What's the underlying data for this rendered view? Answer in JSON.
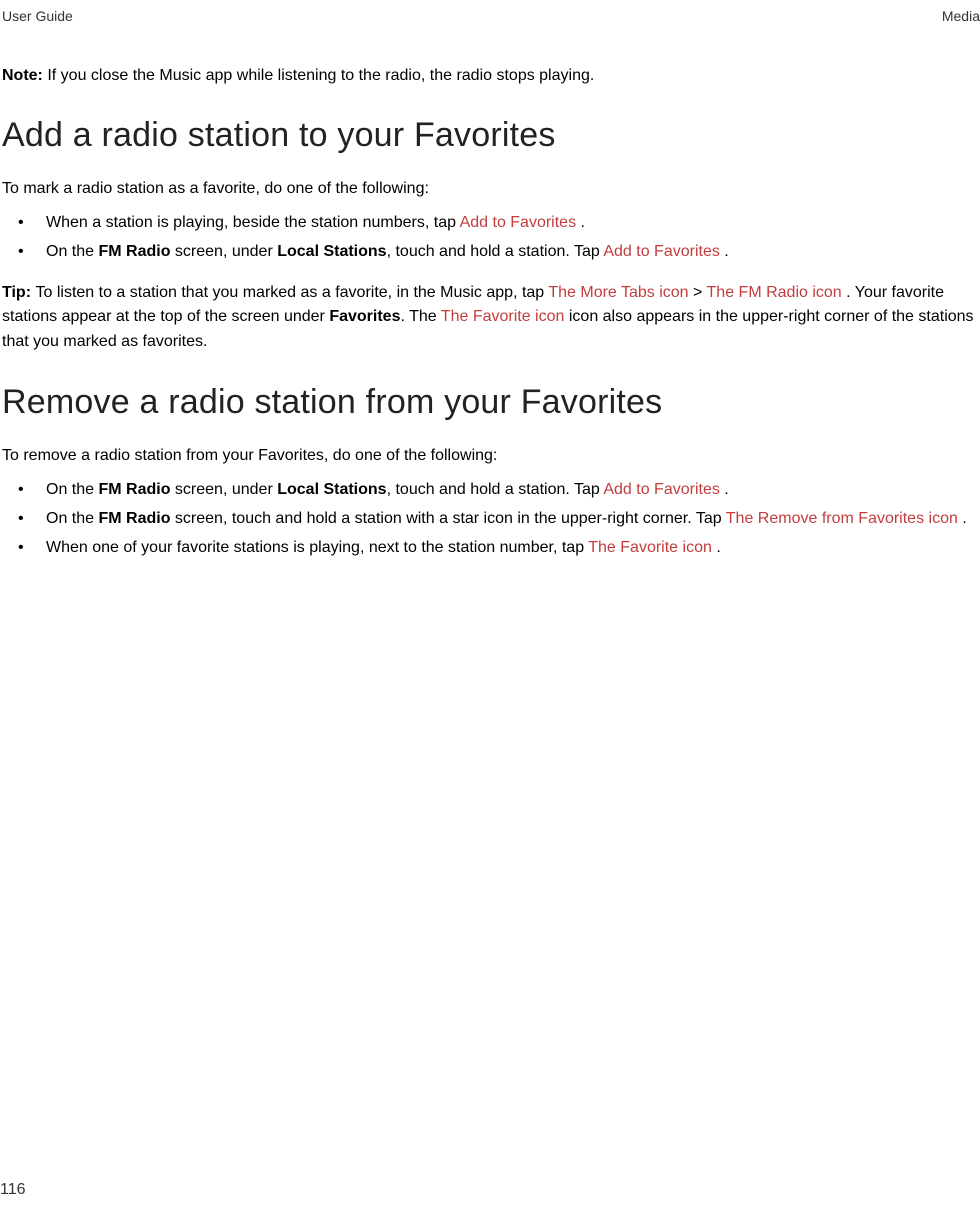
{
  "header": {
    "left": "User Guide",
    "right": "Media"
  },
  "note": {
    "label": "Note: ",
    "text": "If you close the Music app while listening to the radio, the radio stops playing."
  },
  "section1": {
    "heading": "Add a radio station to your Favorites",
    "intro": "To mark a radio station as a favorite, do one of the following:",
    "items": [
      {
        "t1": "When a station is playing, beside the station numbers, tap ",
        "link1": " Add to Favorites ",
        "t2": "."
      },
      {
        "t1": "On the ",
        "b1": "FM Radio",
        "t2": " screen, under ",
        "b2": "Local Stations",
        "t3": ", touch and hold a station. Tap ",
        "link1": " Add to Favorites ",
        "t4": "."
      }
    ],
    "tip": {
      "label": "Tip: ",
      "t1": "To listen to a station that you marked as a favorite, in the Music app, tap ",
      "link1": " The More Tabs icon ",
      "gt": " > ",
      "link2": " The FM Radio icon ",
      "t2": ". Your favorite stations appear at the top of the screen under ",
      "b1": "Favorites",
      "t3": ". The ",
      "link3": " The Favorite icon ",
      "t4": " icon also appears in the upper-right corner of the stations that you marked as favorites."
    }
  },
  "section2": {
    "heading": "Remove a radio station from your Favorites",
    "intro": "To remove a radio station from your Favorites, do one of the following:",
    "items": [
      {
        "t1": "On the ",
        "b1": "FM Radio",
        "t2": " screen, under ",
        "b2": "Local Stations",
        "t3": ", touch and hold a station. Tap ",
        "link1": " Add to Favorites ",
        "t4": "."
      },
      {
        "t1": "On the ",
        "b1": "FM Radio",
        "t2": " screen, touch and hold a station with a star icon in the upper-right corner. Tap ",
        "link1": " The Remove from Favorites icon ",
        "t4": "."
      },
      {
        "t1": "When one of your favorite stations is playing, next to the station number, tap ",
        "link1": " The Favorite icon ",
        "t2": "."
      }
    ]
  },
  "pageNumber": "116"
}
